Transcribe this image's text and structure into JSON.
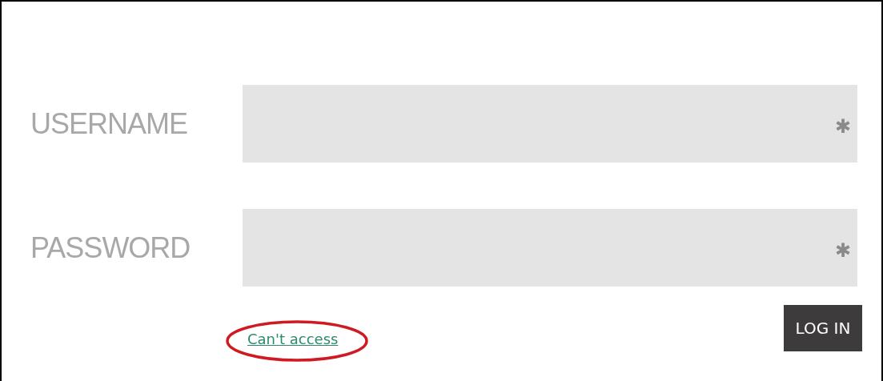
{
  "fields": [
    {
      "label": "USERNAME",
      "required_mark": "✱"
    },
    {
      "label": "PASSWORD",
      "required_mark": "✱"
    }
  ],
  "link": {
    "text": "Can't access",
    "highlight": {
      "kind": "ellipse"
    }
  },
  "button": {
    "label": "LOG IN"
  }
}
